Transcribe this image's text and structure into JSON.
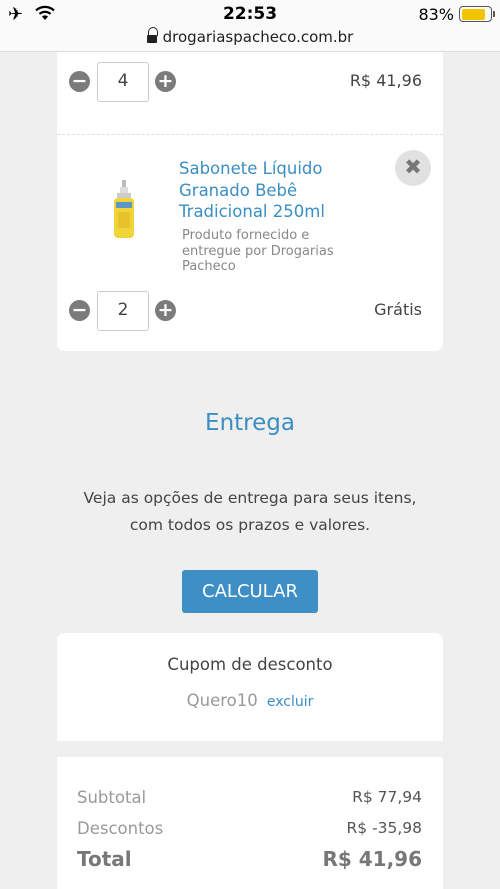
{
  "status_bar": {
    "time": "22:53",
    "battery_percent_text": "83%",
    "battery_level": 0.83,
    "battery_color": "#f5c400"
  },
  "browser": {
    "url": "drogariaspacheco.com.br"
  },
  "cart": {
    "items": [
      {
        "quantity": "4",
        "price": "R$ 41,96"
      },
      {
        "name": "Sabonete Líquido Granado Bebê Tradicional 250ml",
        "seller": "Produto fornecido e entregue por Drogarias Pacheco",
        "quantity": "2",
        "price": "Grátis"
      }
    ]
  },
  "delivery": {
    "title": "Entrega",
    "description_line1": "Veja as opções de entrega para seus itens,",
    "description_line2": "com todos os prazos e valores.",
    "button_label": "CALCULAR"
  },
  "coupon": {
    "title": "Cupom de desconto",
    "code": "Quero10",
    "remove_label": "excluir"
  },
  "totals": {
    "subtotal_label": "Subtotal",
    "subtotal_value": "R$ 77,94",
    "discount_label": "Descontos",
    "discount_value": "R$ -35,98",
    "total_label": "Total",
    "total_value": "R$ 41,96"
  },
  "colors": {
    "accent_blue": "#3b8ec2",
    "button_blue": "#3d8fc6",
    "background": "#efefef"
  },
  "icons": [
    "airplane-icon",
    "wifi-icon",
    "battery-icon",
    "lock-icon",
    "minus-icon",
    "plus-icon",
    "remove-x-icon"
  ]
}
